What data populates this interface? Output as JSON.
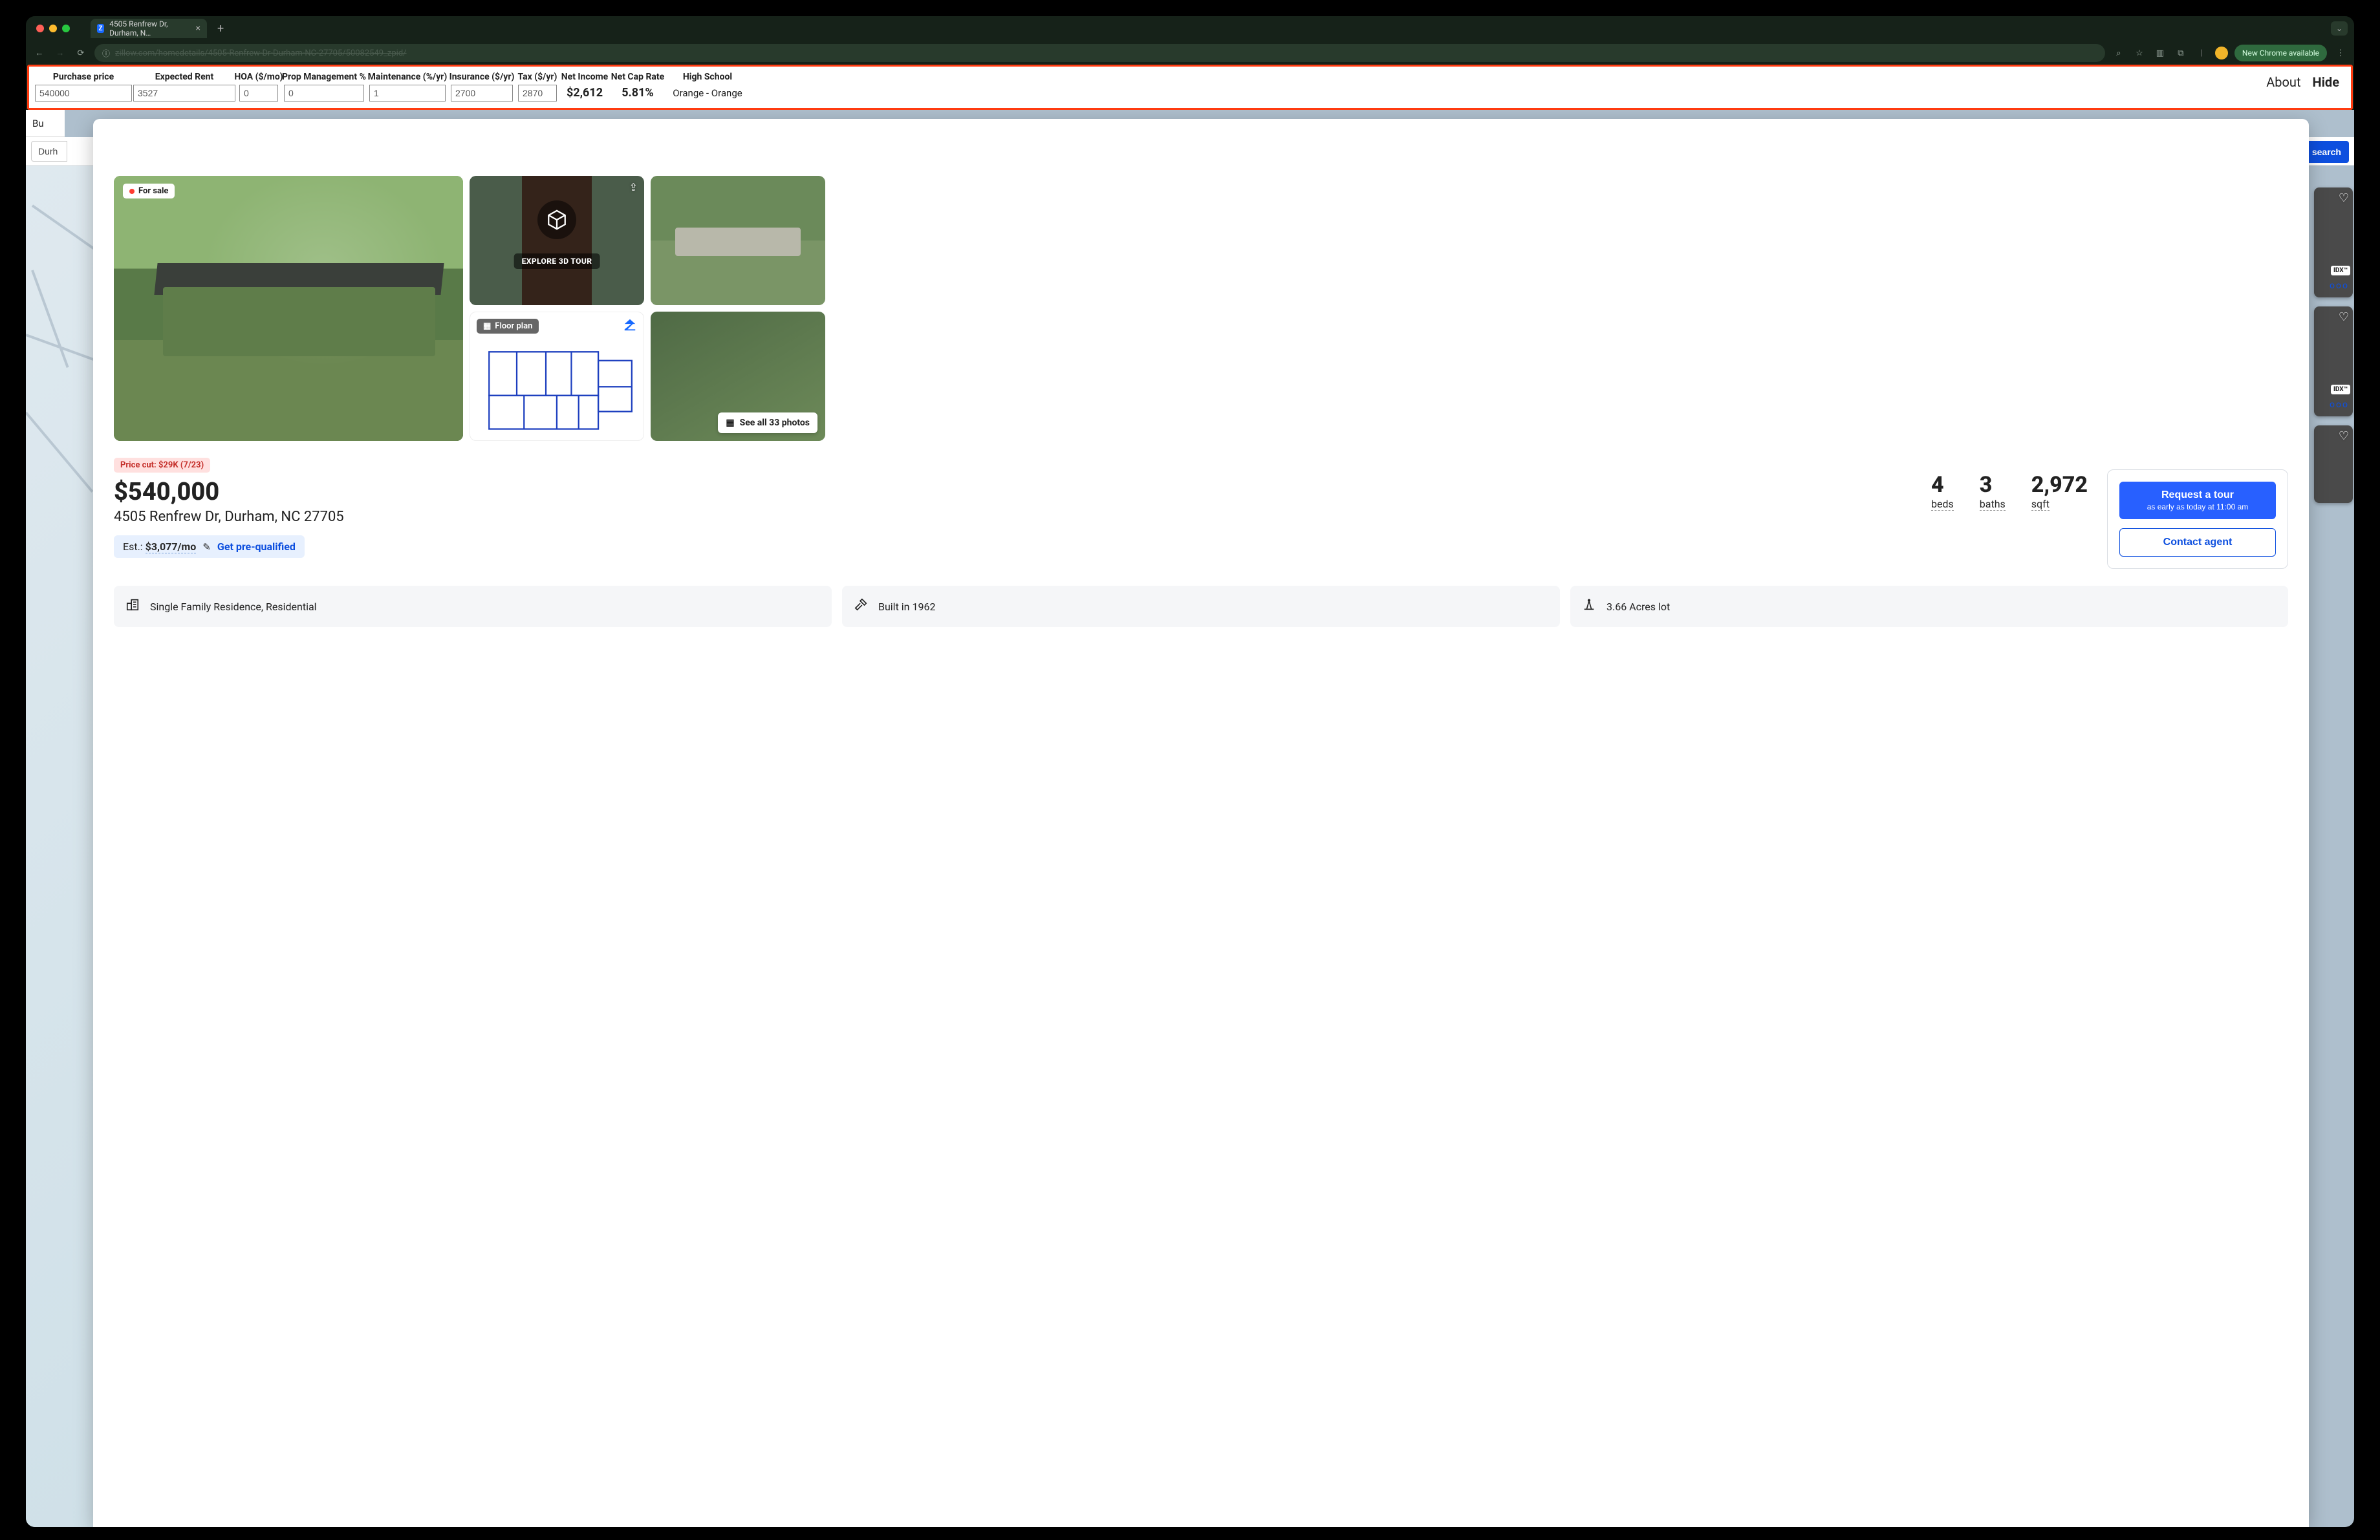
{
  "browser": {
    "tab_title": "4505 Renfrew Dr, Durham, N…",
    "url": "zillow.com/homedetails/4505-Renfrew-Dr-Durham-NC-27705/50082549_zpid/",
    "new_chrome": "New Chrome available"
  },
  "extension": {
    "fields": {
      "purchase_price": {
        "label": "Purchase price",
        "value": "540000"
      },
      "expected_rent": {
        "label": "Expected Rent",
        "value": "3527"
      },
      "hoa": {
        "label": "HOA ($/mo)",
        "value": "0"
      },
      "prop_mgmt": {
        "label": "Prop Management %",
        "value": "0"
      },
      "maintenance": {
        "label": "Maintenance (%/yr)",
        "value": "1"
      },
      "insurance": {
        "label": "Insurance ($/yr)",
        "value": "2700"
      },
      "tax": {
        "label": "Tax ($/yr)",
        "value": "2870"
      }
    },
    "outputs": {
      "net_income": {
        "label": "Net Income",
        "value": "$2,612"
      },
      "net_cap_rate": {
        "label": "Net Cap Rate",
        "value": "5.81%"
      },
      "high_school": {
        "label": "High School",
        "value": "Orange - Orange"
      }
    },
    "links": {
      "about": "About",
      "hide": "Hide"
    }
  },
  "site": {
    "nav_buy": "Bu",
    "search_value": "Durh",
    "save_search": "search"
  },
  "right_rail": {
    "idx_label": "IDX™",
    "dots": "ooo"
  },
  "listing": {
    "for_sale": "For sale",
    "tour_label": "EXPLORE 3D TOUR",
    "floor_plan_chip": "Floor plan",
    "see_all_photos": "See all 33 photos",
    "price_cut": "Price cut: $29K (7/23)",
    "price": "$540,000",
    "address": "4505 Renfrew Dr, Durham, NC 27705",
    "estimate_prefix": "Est.: ",
    "estimate_value": "$3,077/mo",
    "get_prequalified": "Get pre-qualified",
    "facts": {
      "beds": {
        "n": "4",
        "l": "beds"
      },
      "baths": {
        "n": "3",
        "l": "baths"
      },
      "sqft": {
        "n": "2,972",
        "l": "sqft"
      }
    },
    "cta": {
      "request_tour": "Request a tour",
      "request_sub": "as early as today at 11:00 am",
      "contact_agent": "Contact agent"
    },
    "features": {
      "type": "Single Family Residence, Residential",
      "built": "Built in 1962",
      "lot": "3.66 Acres lot"
    }
  }
}
